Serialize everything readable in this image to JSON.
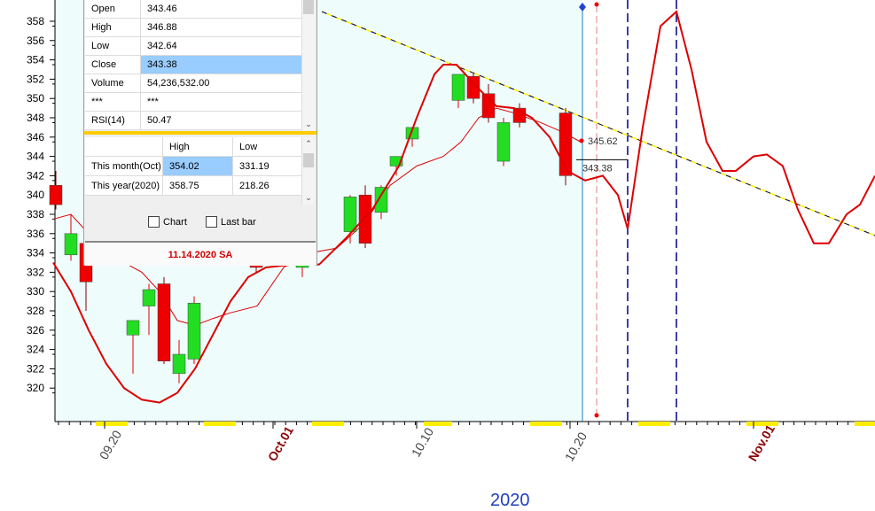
{
  "chart_data": {
    "type": "candlestick",
    "ylim": [
      319,
      359
    ],
    "y_ticks": [
      "320",
      "322",
      "324",
      "326",
      "328",
      "330",
      "332",
      "334",
      "336",
      "338",
      "340",
      "342",
      "344",
      "346",
      "348",
      "350",
      "352",
      "354",
      "356",
      "358"
    ],
    "x_labels": [
      {
        "text": "09.20",
        "color": "#444444"
      },
      {
        "text": "Oct.01",
        "color": "#8b0000"
      },
      {
        "text": "10.10",
        "color": "#444444"
      },
      {
        "text": "10.20",
        "color": "#444444"
      },
      {
        "text": "Nov.01",
        "color": "#8b0000"
      }
    ],
    "year": "2020",
    "candles": [
      {
        "o": 341.0,
        "h": 342.5,
        "l": 338.5,
        "c": 339.0,
        "bull": false
      },
      {
        "o": 333.8,
        "h": 338.0,
        "l": 333.2,
        "c": 336.0,
        "bull": true
      },
      {
        "o": 335.0,
        "h": 336.5,
        "l": 328.0,
        "c": 331.0,
        "bull": false
      },
      {
        "o": 325.5,
        "h": 327.0,
        "l": 321.5,
        "c": 327.0,
        "bull": true
      },
      {
        "o": 328.5,
        "h": 330.8,
        "l": 325.5,
        "c": 330.2,
        "bull": true
      },
      {
        "o": 330.8,
        "h": 331.5,
        "l": 322.5,
        "c": 322.8,
        "bull": false
      },
      {
        "o": 321.5,
        "h": 325.0,
        "l": 320.5,
        "c": 323.5,
        "bull": true
      },
      {
        "o": 323.0,
        "h": 329.5,
        "l": 322.5,
        "c": 328.8,
        "bull": true
      },
      {
        "o": 335.0,
        "h": 336.0,
        "l": 333.0,
        "c": 333.5,
        "bull": false
      },
      {
        "o": 334.0,
        "h": 335.0,
        "l": 332.0,
        "c": 332.5,
        "bull": false
      },
      {
        "o": 333.5,
        "h": 336.0,
        "l": 333.0,
        "c": 334.0,
        "bull": true
      },
      {
        "o": 332.5,
        "h": 335.0,
        "l": 331.5,
        "c": 334.5,
        "bull": true
      },
      {
        "o": 336.2,
        "h": 340.0,
        "l": 335.0,
        "c": 339.8,
        "bull": true
      },
      {
        "o": 340.0,
        "h": 341.0,
        "l": 334.5,
        "c": 335.0,
        "bull": false
      },
      {
        "o": 338.2,
        "h": 341.0,
        "l": 337.5,
        "c": 340.8,
        "bull": true
      },
      {
        "o": 343.0,
        "h": 344.0,
        "l": 342.0,
        "c": 344.0,
        "bull": true
      },
      {
        "o": 345.8,
        "h": 347.0,
        "l": 345.0,
        "c": 347.0,
        "bull": true
      },
      {
        "o": 349.8,
        "h": 352.5,
        "l": 349.0,
        "c": 352.5,
        "bull": true
      },
      {
        "o": 352.3,
        "h": 352.6,
        "l": 349.5,
        "c": 350.0,
        "bull": false
      },
      {
        "o": 350.5,
        "h": 351.5,
        "l": 347.5,
        "c": 348.0,
        "bull": false
      },
      {
        "o": 343.5,
        "h": 348.0,
        "l": 343.0,
        "c": 347.5,
        "bull": true
      },
      {
        "o": 349.0,
        "h": 349.5,
        "l": 347.0,
        "c": 347.5,
        "bull": false
      },
      {
        "o": 348.5,
        "h": 349.0,
        "l": 341.0,
        "c": 342.0,
        "bull": false
      }
    ],
    "forecast_line": [
      [
        332,
        319.5,
        332.7
      ],
      [
        60,
        333.0
      ],
      [
        80,
        330.0
      ],
      [
        100,
        326.0
      ],
      [
        120,
        322.5
      ],
      [
        140,
        320.0
      ],
      [
        160,
        318.8
      ],
      [
        180,
        318.5
      ],
      [
        200,
        319.5
      ],
      [
        220,
        322.0
      ],
      [
        240,
        325.5
      ],
      [
        260,
        329.0
      ],
      [
        280,
        331.5
      ],
      [
        300,
        332.5
      ],
      [
        330,
        332.8
      ],
      [
        360,
        332.8
      ],
      [
        390,
        335.5
      ],
      [
        420,
        338.5
      ],
      [
        450,
        343.0
      ],
      [
        470,
        348.0
      ],
      [
        490,
        352.5
      ],
      [
        500,
        353.5
      ],
      [
        515,
        353.5
      ],
      [
        540,
        351.0
      ],
      [
        560,
        349.2
      ],
      [
        580,
        349.0
      ],
      [
        600,
        348.0
      ],
      [
        620,
        346.0
      ],
      [
        640,
        342.5
      ],
      [
        660,
        341.5
      ],
      [
        680,
        342.0
      ],
      [
        697,
        340.0
      ],
      [
        708,
        336.5
      ],
      [
        725,
        347.0
      ],
      [
        745,
        357.5
      ],
      [
        763,
        359.0
      ],
      [
        780,
        353.0
      ],
      [
        797,
        345.5
      ],
      [
        815,
        342.5
      ],
      [
        830,
        342.5
      ],
      [
        850,
        344.0
      ],
      [
        865,
        344.2
      ],
      [
        883,
        343.0
      ],
      [
        900,
        338.5
      ],
      [
        918,
        335.0
      ],
      [
        935,
        335.0
      ],
      [
        955,
        338.0
      ],
      [
        970,
        339.0
      ],
      [
        987,
        342.0
      ]
    ],
    "moving_average": [
      [
        60,
        337.5
      ],
      [
        80,
        338.0
      ],
      [
        100,
        336.0
      ],
      [
        120,
        335.0
      ],
      [
        140,
        333.0
      ],
      [
        160,
        332.0
      ],
      [
        180,
        330.0
      ],
      [
        200,
        327.0
      ],
      [
        220,
        326.5
      ],
      [
        240,
        327.2
      ],
      [
        260,
        327.8
      ],
      [
        290,
        328.5
      ],
      [
        320,
        332.5
      ],
      [
        350,
        334.0
      ],
      [
        380,
        334.5
      ],
      [
        410,
        337.0
      ],
      [
        440,
        341.0
      ],
      [
        470,
        343.0
      ],
      [
        500,
        344.0
      ],
      [
        520,
        345.5
      ],
      [
        540,
        348.0
      ],
      [
        560,
        349.0
      ],
      [
        580,
        348.5
      ],
      [
        610,
        347.5
      ],
      [
        635,
        346.5
      ],
      [
        655,
        345.5
      ]
    ],
    "trendline": {
      "from": [
        363,
        359.0
      ],
      "to": [
        987,
        335.8
      ]
    },
    "price_labels": [
      {
        "text": "345.62",
        "value": 345.62
      },
      {
        "text": "343.38",
        "value": 343.38
      }
    ]
  },
  "ohlc": [
    {
      "label": "Open",
      "value": "343.46"
    },
    {
      "label": "High",
      "value": "346.88"
    },
    {
      "label": "Low",
      "value": "342.64"
    },
    {
      "label": "Close",
      "value": "343.38",
      "selected": true
    },
    {
      "label": "Volume",
      "value": "54,236,532.00"
    },
    {
      "label": "***",
      "value": "***"
    },
    {
      "label": "RSI(14)",
      "value": "50.47"
    }
  ],
  "hl_table": {
    "headers": [
      "High",
      "Low"
    ],
    "rows": [
      {
        "label": "This month(Oct)",
        "high": "354.02",
        "low": "331.19"
      },
      {
        "label": "This year(2020)",
        "high": "358.75",
        "low": "218.26"
      }
    ]
  },
  "checks": {
    "chart": "Chart",
    "last_bar": "Last bar"
  },
  "date_text": "11.14.2020 SA",
  "colors": {
    "bull": "#22dd22",
    "bear": "#ee0000",
    "line": "#dd0000",
    "bg_area": "#eefcfc",
    "yellow": "#ffee00"
  }
}
